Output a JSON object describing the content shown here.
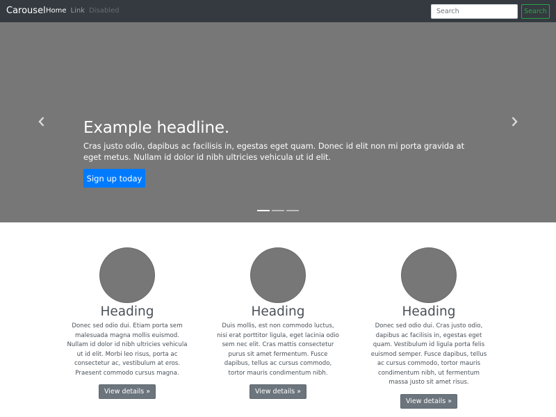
{
  "navbar": {
    "brand": "Carousel",
    "links": [
      {
        "label": "Home",
        "state": "active"
      },
      {
        "label": "Link",
        "state": "normal"
      },
      {
        "label": "Disabled",
        "state": "disabled"
      }
    ],
    "search": {
      "placeholder": "Search",
      "value": ""
    },
    "search_button": "Search"
  },
  "carousel": {
    "prev_icon": "chevron-left-icon",
    "next_icon": "chevron-right-icon",
    "headline": "Example headline.",
    "lead": "Cras justo odio, dapibus ac facilisis in, egestas eget quam. Donec id elit non mi porta gravida at eget metus. Nullam id dolor id nibh ultricies vehicula ut id elit.",
    "button": "Sign up today",
    "slides_total": 3,
    "active_slide": 1
  },
  "marketing": [
    {
      "heading": "Heading",
      "text": "Donec sed odio dui. Etiam porta sem malesuada magna mollis euismod. Nullam id dolor id nibh ultricies vehicula ut id elit. Morbi leo risus, porta ac consectetur ac, vestibulum at eros. Praesent commodo cursus magna.",
      "button": "View details »"
    },
    {
      "heading": "Heading",
      "text": "Duis mollis, est non commodo luctus, nisi erat porttitor ligula, eget lacinia odio sem nec elit. Cras mattis consectetur purus sit amet fermentum. Fusce dapibus, tellus ac cursus commodo, tortor mauris condimentum nibh.",
      "button": "View details »"
    },
    {
      "heading": "Heading",
      "text": "Donec sed odio dui. Cras justo odio, dapibus ac facilisis in, egestas eget quam. Vestibulum id ligula porta felis euismod semper. Fusce dapibus, tellus ac cursus commodo, tortor mauris condimentum nibh, ut fermentum massa justo sit amet risus.",
      "button": "View details »"
    }
  ],
  "colors": {
    "navbar_bg": "#343a40",
    "carousel_bg": "#777777",
    "primary": "#007bff",
    "success": "#28a745",
    "secondary": "#6c757d"
  }
}
